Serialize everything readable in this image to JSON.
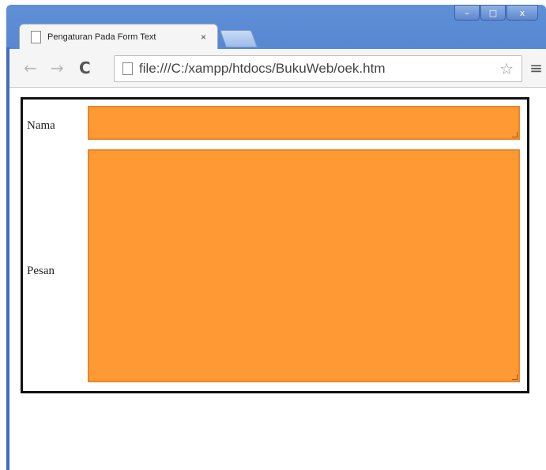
{
  "browser": {
    "tab_title": "Pengaturan Pada Form Text",
    "tab_close": "×",
    "url": "file:///C:/xampp/htdocs/BukuWeb/oek.htm",
    "window_controls": {
      "minimize": "–",
      "maximize": "□",
      "close": "x"
    },
    "nav": {
      "back": "←",
      "forward": "→",
      "reload": "C",
      "star": "☆",
      "menu": "≡"
    }
  },
  "form": {
    "nama_label": "Nama",
    "pesan_label": "Pesan",
    "nama_value": "",
    "pesan_value": "",
    "field_color": "#ff9933",
    "border_color": "#111111"
  }
}
